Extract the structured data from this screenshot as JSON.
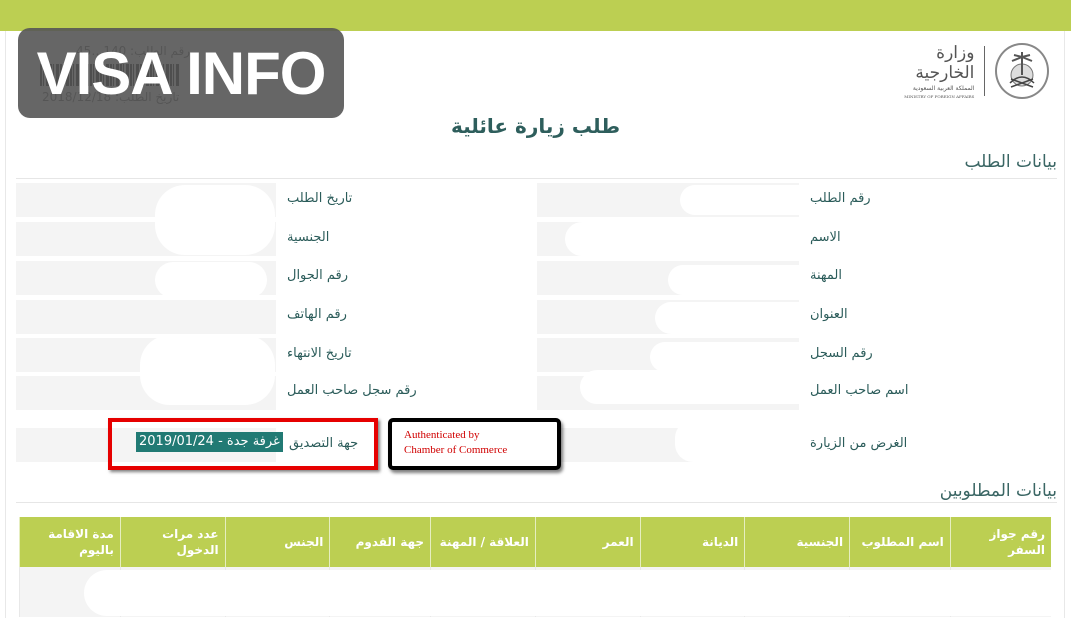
{
  "overlay": {
    "badge_text": "VISA INFO"
  },
  "header": {
    "request_number_text": "رقم الطلب: 140…45",
    "request_date_text": "تاريخ الطلب: 2018/12/18",
    "logo": {
      "arabic_title": "وزارة الخارجية",
      "arabic_subtitle": "المملكة العربية السعودية",
      "english_subtitle": "MINISTRY OF FOREIGN AFFAIRS",
      "emblem_icon": "saudi-emblem-icon"
    },
    "page_title": "طلب زيارة عائلية"
  },
  "request_section": {
    "title": "بيانات الطلب",
    "right_fields": [
      {
        "label": "رقم الطلب",
        "value": ""
      },
      {
        "label": "الاسم",
        "value": ""
      },
      {
        "label": "المهنة",
        "value": ""
      },
      {
        "label": "العنوان",
        "value": ""
      },
      {
        "label": "رقم السجل",
        "value": ""
      },
      {
        "label": "اسم صاحب العمل",
        "value": ""
      },
      {
        "label": "الغرض من الزيارة",
        "value": ""
      }
    ],
    "left_fields": [
      {
        "label": "تاريخ الطلب",
        "value": ""
      },
      {
        "label": "الجنسية",
        "value": ""
      },
      {
        "label": "رقم الجوال",
        "value": ""
      },
      {
        "label": "رقم الهاتف",
        "value": ""
      },
      {
        "label": "تاريخ الانتهاء",
        "value": ""
      },
      {
        "label": "رقم سجل صاحب العمل",
        "value": ""
      },
      {
        "label": "جهة التصديق",
        "value": "غرفة جدة - 2019/01/24"
      }
    ]
  },
  "annotation": {
    "callout_line1": "Authenticated by",
    "callout_line2": "Chamber of Commerce",
    "highlight_color": "#e60000"
  },
  "persons_section": {
    "title": "بيانات المطلوبين",
    "columns": [
      "رقم جواز السفر",
      "اسم المطلوب",
      "الجنسية",
      "الديانة",
      "العمر",
      "العلاقة / المهنة",
      "جهة القدوم",
      "الجنس",
      "عدد مرات الدخول",
      "مدة الاقامة باليوم"
    ],
    "rows": [
      [
        "",
        "",
        "",
        "",
        "",
        "",
        "",
        "",
        "",
        ""
      ]
    ]
  },
  "colors": {
    "accent_green": "#bccf52",
    "teal_text": "#2b5c5a",
    "selected_bg": "#217a74"
  }
}
